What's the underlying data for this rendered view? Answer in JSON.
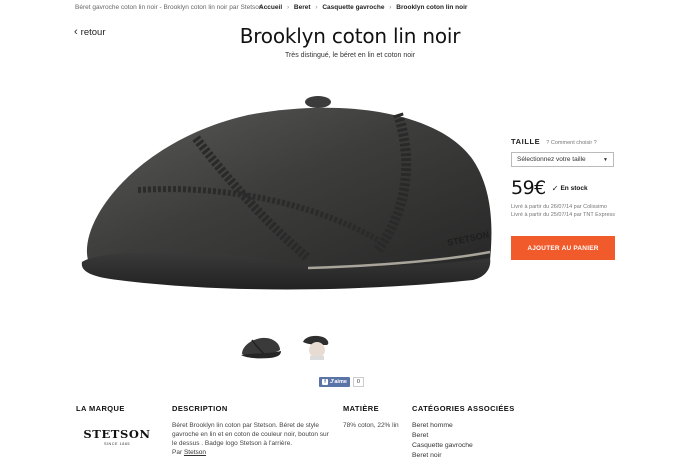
{
  "top": {
    "page_title": "Béret gavroche coton lin noir - Brooklyn coton lin noir par Stetson",
    "breadcrumbs": [
      "Accueil",
      "Beret",
      "Casquette gavroche",
      "Brooklyn coton lin noir"
    ],
    "separator": "›"
  },
  "nav": {
    "back_label": "retour"
  },
  "product": {
    "title": "Brooklyn coton lin noir",
    "subtitle": "Très distingué, le béret en lin et coton noir"
  },
  "purchase": {
    "size_label": "TAILLE",
    "size_help": "Comment choisir ?",
    "size_placeholder": "Sélectionnez votre taille",
    "price": "59€",
    "stock": "En stock",
    "delivery_1": "Livré à partir du 26/07/14 par Colissimo",
    "delivery_2": "Livré à partir du 25/07/14 par TNT Express",
    "add_to_cart": "AJOUTER AU PANIER"
  },
  "social": {
    "like_label": "J'aime",
    "like_count": "0"
  },
  "details": {
    "brand_heading": "LA MARQUE",
    "brand_logo_name": "STETSON",
    "brand_logo_since": "SINCE 1865",
    "description_heading": "DESCRIPTION",
    "description_text": "Béret Brooklyn lin coton par Stetson. Béret de style gavroche en lin et en coton de couleur noir, bouton sur le dessus . Badge logo Stetson à l'arrière.",
    "description_by": "Par",
    "description_brand_link": "Stetson",
    "material_heading": "MATIÈRE",
    "material_text": "78% coton, 22% lin",
    "categories_heading": "CATÉGORIES ASSOCIÉES",
    "categories": [
      "Beret homme",
      "Beret",
      "Casquette gavroche",
      "Beret noir"
    ]
  },
  "colors": {
    "accent": "#f15a2b",
    "facebook": "#5b74a8",
    "cap_dark": "#3a3a3a"
  }
}
